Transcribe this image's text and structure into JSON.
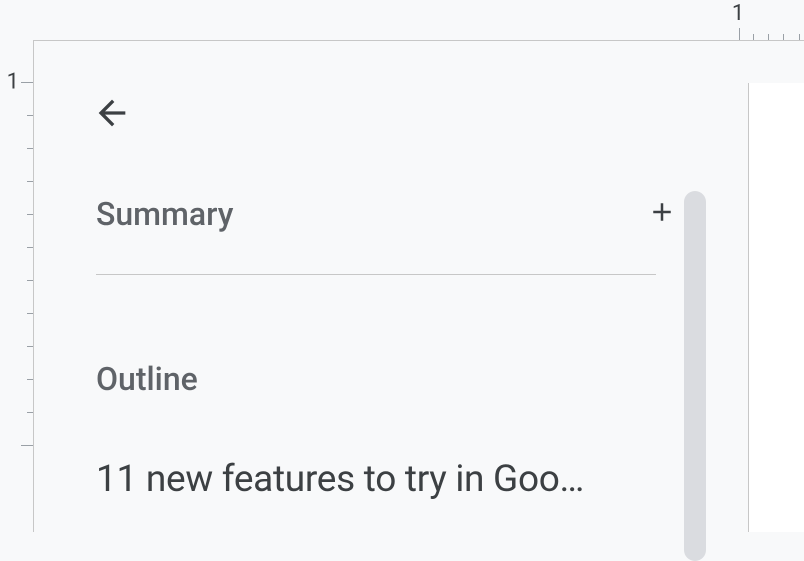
{
  "ruler": {
    "horizontalLabel": "1",
    "verticalLabel": "1"
  },
  "sidebar": {
    "summaryLabel": "Summary",
    "outlineLabel": "Outline",
    "items": [
      {
        "text": "11 new features to try in Goo…"
      }
    ]
  }
}
